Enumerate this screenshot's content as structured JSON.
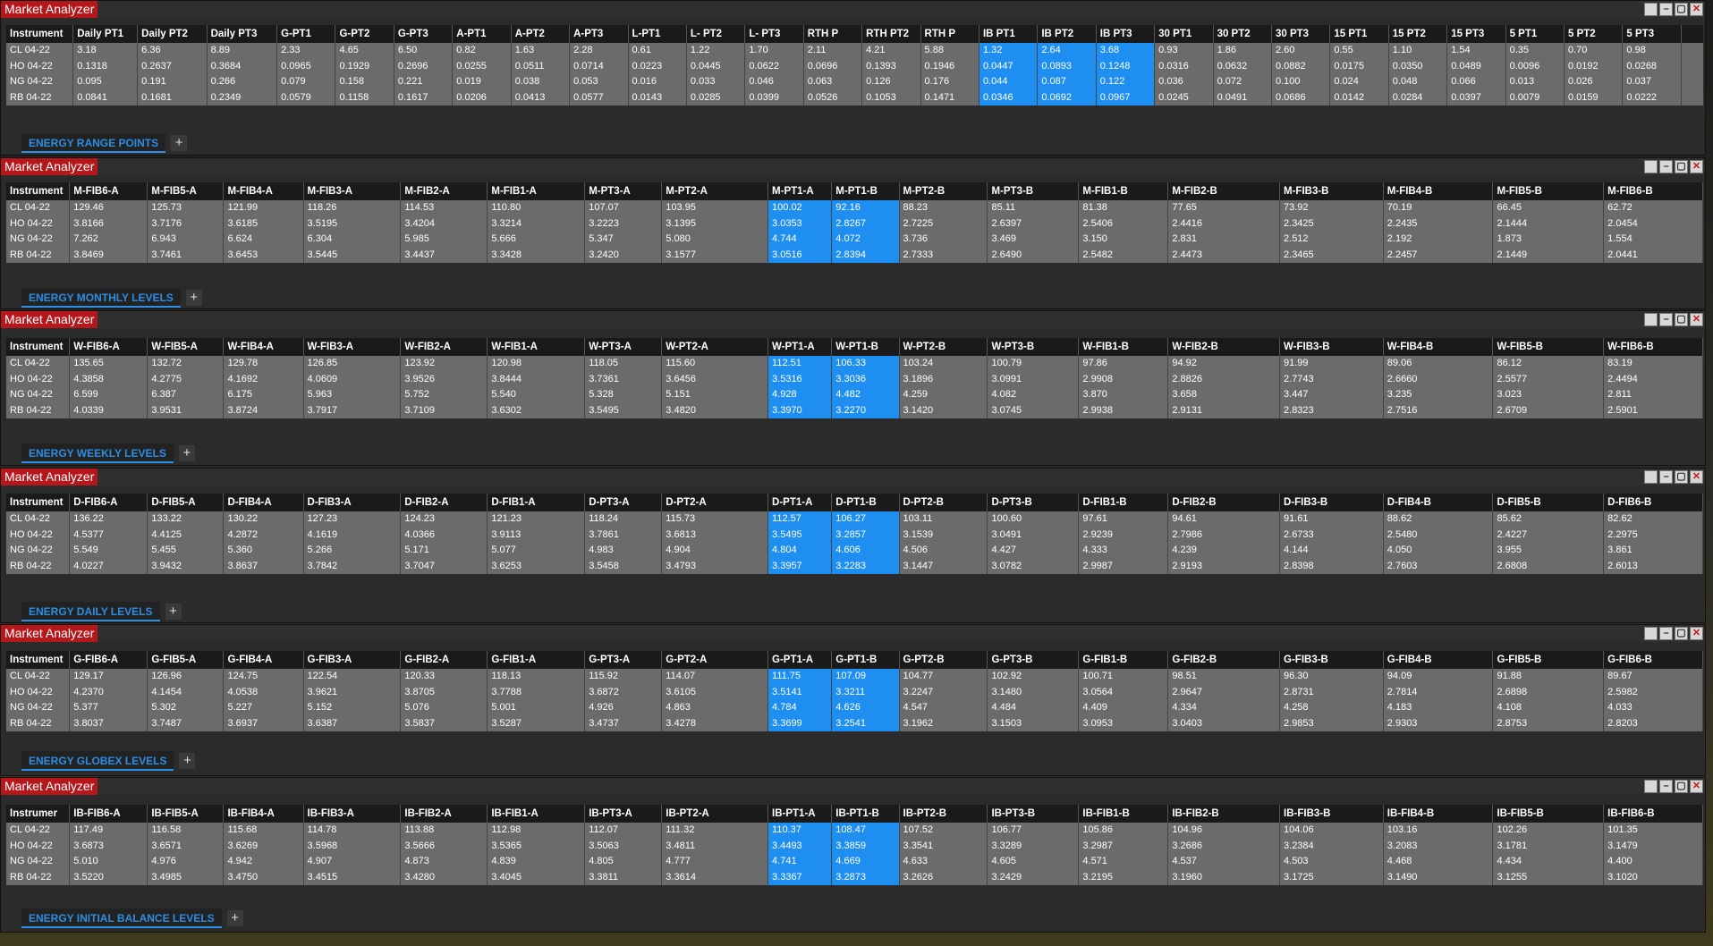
{
  "panels": [
    {
      "title": "Market Analyzer",
      "tab": "ENERGY RANGE POINTS",
      "headers": [
        "Instrument",
        "Daily PT1",
        "Daily PT2",
        "Daily PT3",
        "G-PT1",
        "G-PT2",
        "G-PT3",
        "A-PT1",
        "A-PT2",
        "A-PT3",
        "L-PT1",
        "L- PT2",
        "L- PT3",
        "RTH P",
        "RTH PT2",
        "RTH P",
        "IB PT1",
        "IB PT2",
        "IB PT3",
        "30 PT1",
        "30 PT2",
        "30 PT3",
        "15 PT1",
        "15 PT2",
        "15 PT3",
        "5 PT1",
        "5 PT2",
        "5 PT3"
      ],
      "rows": [
        [
          "CL 04-22",
          "3.18",
          "6.36",
          "8.89",
          "2.33",
          "4.65",
          "6.50",
          "0.82",
          "1.63",
          "2.28",
          "0.61",
          "1.22",
          "1.70",
          "2.11",
          "4.21",
          "5.88",
          "1.32",
          "2.64",
          "3.68",
          "0.93",
          "1.86",
          "2.60",
          "0.55",
          "1.10",
          "1.54",
          "0.35",
          "0.70",
          "0.98"
        ],
        [
          "HO 04-22",
          "0.1318",
          "0.2637",
          "0.3684",
          "0.0965",
          "0.1929",
          "0.2696",
          "0.0255",
          "0.0511",
          "0.0714",
          "0.0223",
          "0.0445",
          "0.0622",
          "0.0696",
          "0.1393",
          "0.1946",
          "0.0447",
          "0.0893",
          "0.1248",
          "0.0316",
          "0.0632",
          "0.0882",
          "0.0175",
          "0.0350",
          "0.0489",
          "0.0096",
          "0.0192",
          "0.0268"
        ],
        [
          "NG 04-22",
          "0.095",
          "0.191",
          "0.266",
          "0.079",
          "0.158",
          "0.221",
          "0.019",
          "0.038",
          "0.053",
          "0.016",
          "0.033",
          "0.046",
          "0.063",
          "0.126",
          "0.176",
          "0.044",
          "0.087",
          "0.122",
          "0.036",
          "0.072",
          "0.100",
          "0.024",
          "0.048",
          "0.066",
          "0.013",
          "0.026",
          "0.037"
        ],
        [
          "RB 04-22",
          "0.0841",
          "0.1681",
          "0.2349",
          "0.0579",
          "0.1158",
          "0.1617",
          "0.0206",
          "0.0413",
          "0.0577",
          "0.0143",
          "0.0285",
          "0.0399",
          "0.0526",
          "0.1053",
          "0.1471",
          "0.0346",
          "0.0692",
          "0.0967",
          "0.0245",
          "0.0491",
          "0.0686",
          "0.0142",
          "0.0284",
          "0.0397",
          "0.0079",
          "0.0159",
          "0.0222"
        ]
      ]
    },
    {
      "title": "Market Analyzer",
      "tab": "ENERGY MONTHLY LEVELS",
      "headers": [
        "Instrument",
        "M-FIB6-A",
        "M-FIB5-A",
        "M-FIB4-A",
        "M-FIB3-A",
        "M-FIB2-A",
        "M-FIB1-A",
        "M-PT3-A",
        "M-PT2-A",
        "M-PT1-A",
        "M-PT1-B",
        "M-PT2-B",
        "M-PT3-B",
        "M-FIB1-B",
        "M-FIB2-B",
        "M-FIB3-B",
        "M-FIB4-B",
        "M-FIB5-B",
        "M-FIB6-B"
      ],
      "rows": [
        [
          "CL 04-22",
          "129.46",
          "125.73",
          "121.99",
          "118.26",
          "114.53",
          "110.80",
          "107.07",
          "103.95",
          "100.02",
          "92.16",
          "88.23",
          "85.11",
          "81.38",
          "77.65",
          "73.92",
          "70.19",
          "66.45",
          "62.72"
        ],
        [
          "HO 04-22",
          "3.8166",
          "3.7176",
          "3.6185",
          "3.5195",
          "3.4204",
          "3.3214",
          "3.2223",
          "3.1395",
          "3.0353",
          "2.8267",
          "2.7225",
          "2.6397",
          "2.5406",
          "2.4416",
          "2.3425",
          "2.2435",
          "2.1444",
          "2.0454"
        ],
        [
          "NG 04-22",
          "7.262",
          "6.943",
          "6.624",
          "6.304",
          "5.985",
          "5.666",
          "5.347",
          "5.080",
          "4.744",
          "4.072",
          "3.736",
          "3.469",
          "3.150",
          "2.831",
          "2.512",
          "2.192",
          "1.873",
          "1.554"
        ],
        [
          "RB 04-22",
          "3.8469",
          "3.7461",
          "3.6453",
          "3.5445",
          "3.4437",
          "3.3428",
          "3.2420",
          "3.1577",
          "3.0516",
          "2.8394",
          "2.7333",
          "2.6490",
          "2.5482",
          "2.4473",
          "2.3465",
          "2.2457",
          "2.1449",
          "2.0441"
        ]
      ]
    },
    {
      "title": "Market Analyzer",
      "tab": "ENERGY WEEKLY LEVELS",
      "headers": [
        "Instrument",
        "W-FIB6-A",
        "W-FIB5-A",
        "W-FIB4-A",
        "W-FIB3-A",
        "W-FIB2-A",
        "W-FIB1-A",
        "W-PT3-A",
        "W-PT2-A",
        "W-PT1-A",
        "W-PT1-B",
        "W-PT2-B",
        "W-PT3-B",
        "W-FIB1-B",
        "W-FIB2-B",
        "W-FIB3-B",
        "W-FIB4-B",
        "W-FIB5-B",
        "W-FIB6-B"
      ],
      "rows": [
        [
          "CL 04-22",
          "135.65",
          "132.72",
          "129.78",
          "126.85",
          "123.92",
          "120.98",
          "118.05",
          "115.60",
          "112.51",
          "106.33",
          "103.24",
          "100.79",
          "97.86",
          "94.92",
          "91.99",
          "89.06",
          "86.12",
          "83.19"
        ],
        [
          "HO 04-22",
          "4.3858",
          "4.2775",
          "4.1692",
          "4.0609",
          "3.9526",
          "3.8444",
          "3.7361",
          "3.6456",
          "3.5316",
          "3.3036",
          "3.1896",
          "3.0991",
          "2.9908",
          "2.8826",
          "2.7743",
          "2.6660",
          "2.5577",
          "2.4494"
        ],
        [
          "NG 04-22",
          "6.599",
          "6.387",
          "6.175",
          "5.963",
          "5.752",
          "5.540",
          "5.328",
          "5.151",
          "4.928",
          "4.482",
          "4.259",
          "4.082",
          "3.870",
          "3.658",
          "3.447",
          "3.235",
          "3.023",
          "2.811"
        ],
        [
          "RB 04-22",
          "4.0339",
          "3.9531",
          "3.8724",
          "3.7917",
          "3.7109",
          "3.6302",
          "3.5495",
          "3.4820",
          "3.3970",
          "3.2270",
          "3.1420",
          "3.0745",
          "2.9938",
          "2.9131",
          "2.8323",
          "2.7516",
          "2.6709",
          "2.5901"
        ]
      ]
    },
    {
      "title": "Market Analyzer",
      "tab": "ENERGY DAILY LEVELS",
      "headers": [
        "Instrument",
        "D-FIB6-A",
        "D-FIB5-A",
        "D-FIB4-A",
        "D-FIB3-A",
        "D-FIB2-A",
        "D-FIB1-A",
        "D-PT3-A",
        "D-PT2-A",
        "D-PT1-A",
        "D-PT1-B",
        "D-PT2-B",
        "D-PT3-B",
        "D-FIB1-B",
        "D-FIB2-B",
        "D-FIB3-B",
        "D-FIB4-B",
        "D-FIB5-B",
        "D-FIB6-B"
      ],
      "rows": [
        [
          "CL 04-22",
          "136.22",
          "133.22",
          "130.22",
          "127.23",
          "124.23",
          "121.23",
          "118.24",
          "115.73",
          "112.57",
          "106.27",
          "103.11",
          "100.60",
          "97.61",
          "94.61",
          "91.61",
          "88.62",
          "85.62",
          "82.62"
        ],
        [
          "HO 04-22",
          "4.5377",
          "4.4125",
          "4.2872",
          "4.1619",
          "4.0366",
          "3.9113",
          "3.7861",
          "3.6813",
          "3.5495",
          "3.2857",
          "3.1539",
          "3.0491",
          "2.9239",
          "2.7986",
          "2.6733",
          "2.5480",
          "2.4227",
          "2.2975"
        ],
        [
          "NG 04-22",
          "5.549",
          "5.455",
          "5.360",
          "5.266",
          "5.171",
          "5.077",
          "4.983",
          "4.904",
          "4.804",
          "4.606",
          "4.506",
          "4.427",
          "4.333",
          "4.239",
          "4.144",
          "4.050",
          "3.955",
          "3.861"
        ],
        [
          "RB 04-22",
          "4.0227",
          "3.9432",
          "3.8637",
          "3.7842",
          "3.7047",
          "3.6253",
          "3.5458",
          "3.4793",
          "3.3957",
          "3.2283",
          "3.1447",
          "3.0782",
          "2.9987",
          "2.9193",
          "2.8398",
          "2.7603",
          "2.6808",
          "2.6013"
        ]
      ]
    },
    {
      "title": "Market Analyzer",
      "tab": "ENERGY GLOBEX LEVELS",
      "headers": [
        "Instrument",
        "G-FIB6-A",
        "G-FIB5-A",
        "G-FIB4-A",
        "G-FIB3-A",
        "G-FIB2-A",
        "G-FIB1-A",
        "G-PT3-A",
        "G-PT2-A",
        "G-PT1-A",
        "G-PT1-B",
        "G-PT2-B",
        "G-PT3-B",
        "G-FIB1-B",
        "G-FIB2-B",
        "G-FIB3-B",
        "G-FIB4-B",
        "G-FIB5-B",
        "G-FIB6-B"
      ],
      "rows": [
        [
          "CL 04-22",
          "129.17",
          "126.96",
          "124.75",
          "122.54",
          "120.33",
          "118.13",
          "115.92",
          "114.07",
          "111.75",
          "107.09",
          "104.77",
          "102.92",
          "100.71",
          "98.51",
          "96.30",
          "94.09",
          "91.88",
          "89.67"
        ],
        [
          "HO 04-22",
          "4.2370",
          "4.1454",
          "4.0538",
          "3.9621",
          "3.8705",
          "3.7788",
          "3.6872",
          "3.6105",
          "3.5141",
          "3.3211",
          "3.2247",
          "3.1480",
          "3.0564",
          "2.9647",
          "2.8731",
          "2.7814",
          "2.6898",
          "2.5982"
        ],
        [
          "NG 04-22",
          "5.377",
          "5.302",
          "5.227",
          "5.152",
          "5.076",
          "5.001",
          "4.926",
          "4.863",
          "4.784",
          "4.626",
          "4.547",
          "4.484",
          "4.409",
          "4.334",
          "4.258",
          "4.183",
          "4.108",
          "4.033"
        ],
        [
          "RB 04-22",
          "3.8037",
          "3.7487",
          "3.6937",
          "3.6387",
          "3.5837",
          "3.5287",
          "3.4737",
          "3.4278",
          "3.3699",
          "3.2541",
          "3.1962",
          "3.1503",
          "3.0953",
          "3.0403",
          "2.9853",
          "2.9303",
          "2.8753",
          "2.8203"
        ]
      ]
    },
    {
      "title": "Market Analyzer",
      "tab": "ENERGY INITIAL BALANCE LEVELS",
      "headers": [
        "Instrumer",
        "IB-FIB6-A",
        "IB-FIB5-A",
        "IB-FIB4-A",
        "IB-FIB3-A",
        "IB-FIB2-A",
        "IB-FIB1-A",
        "IB-PT3-A",
        "IB-PT2-A",
        "IB-PT1-A",
        "IB-PT1-B",
        "IB-PT2-B",
        "IB-PT3-B",
        "IB-FIB1-B",
        "IB-FIB2-B",
        "IB-FIB3-B",
        "IB-FIB4-B",
        "IB-FIB5-B",
        "IB-FIB6-B"
      ],
      "rows": [
        [
          "CL 04-22",
          "117.49",
          "116.58",
          "115.68",
          "114.78",
          "113.88",
          "112.98",
          "112.07",
          "111.32",
          "110.37",
          "108.47",
          "107.52",
          "106.77",
          "105.86",
          "104.96",
          "104.06",
          "103.16",
          "102.26",
          "101.35"
        ],
        [
          "HO 04-22",
          "3.6873",
          "3.6571",
          "3.6269",
          "3.5968",
          "3.5666",
          "3.5365",
          "3.5063",
          "3.4811",
          "3.4493",
          "3.3859",
          "3.3541",
          "3.3289",
          "3.2987",
          "3.2686",
          "3.2384",
          "3.2083",
          "3.1781",
          "3.1479"
        ],
        [
          "NG 04-22",
          "5.010",
          "4.976",
          "4.942",
          "4.907",
          "4.873",
          "4.839",
          "4.805",
          "4.777",
          "4.741",
          "4.669",
          "4.633",
          "4.605",
          "4.571",
          "4.537",
          "4.503",
          "4.468",
          "4.434",
          "4.400"
        ],
        [
          "RB 04-22",
          "3.5220",
          "3.4985",
          "3.4750",
          "3.4515",
          "3.4280",
          "3.4045",
          "3.3811",
          "3.3614",
          "3.3367",
          "3.2873",
          "3.2626",
          "3.2429",
          "3.2195",
          "3.1960",
          "3.1725",
          "3.1490",
          "3.1255",
          "3.1020"
        ]
      ]
    }
  ],
  "colors": {
    "highlight": "#1e8ef0",
    "title_bg": "#b5171b",
    "tab_text": "#2c8de4"
  },
  "icons": {
    "add_tab": "plus-icon",
    "window_controls": [
      "restore-icon",
      "minimize-icon",
      "maximize-icon",
      "close-icon"
    ]
  }
}
